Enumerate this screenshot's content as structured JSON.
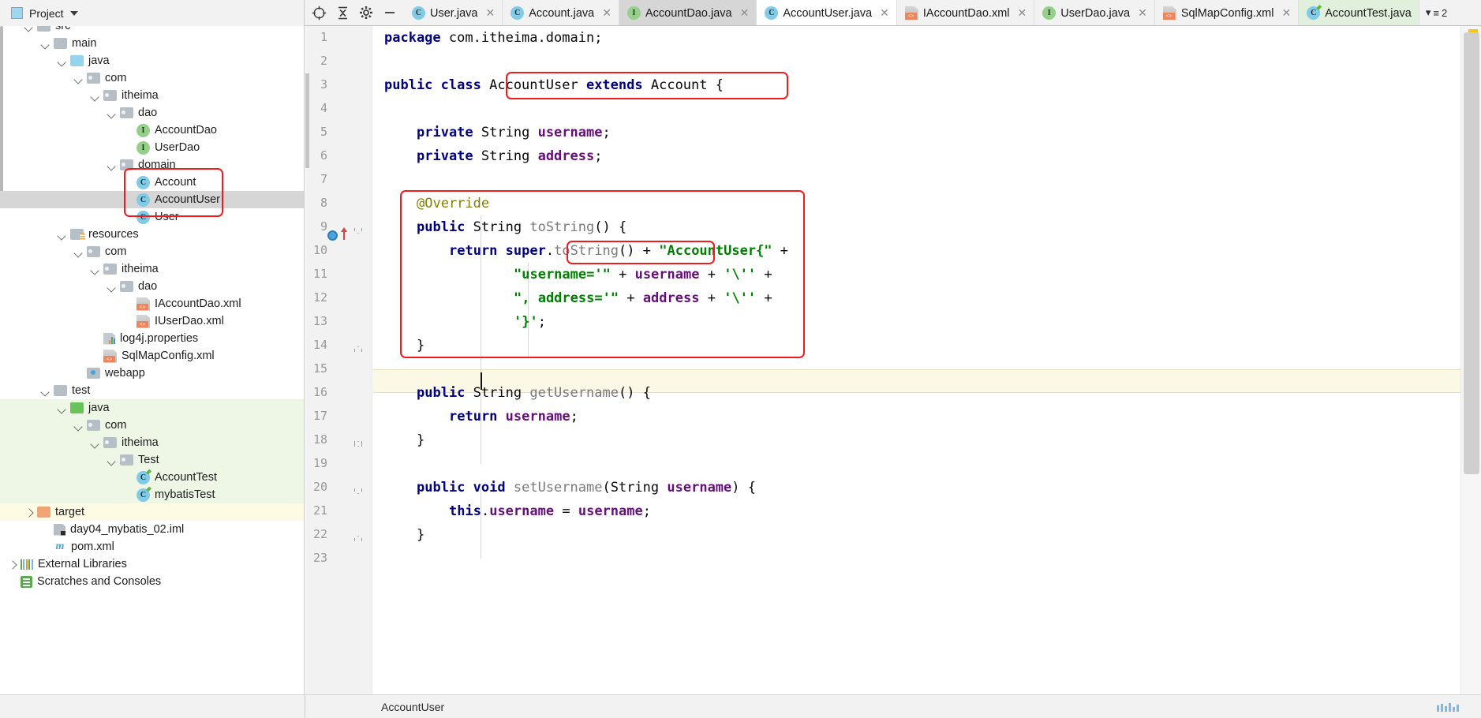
{
  "window": {
    "project_panel_title": "Project",
    "toolbar_icons": [
      "locate-icon",
      "collapse-all-icon",
      "settings-gear-icon",
      "hide-icon"
    ]
  },
  "tabs": {
    "items": [
      {
        "label": "User.java",
        "icon": "class-icon",
        "state": "inactive",
        "closable": true
      },
      {
        "label": "Account.java",
        "icon": "class-icon",
        "state": "inactive",
        "closable": true
      },
      {
        "label": "AccountDao.java",
        "icon": "interface-icon",
        "state": "hover",
        "closable": true
      },
      {
        "label": "AccountUser.java",
        "icon": "class-icon",
        "state": "active",
        "closable": true
      },
      {
        "label": "IAccountDao.xml",
        "icon": "xml-file-icon",
        "state": "inactive",
        "closable": true
      },
      {
        "label": "UserDao.java",
        "icon": "interface-icon",
        "state": "inactive",
        "closable": true
      },
      {
        "label": "SqlMapConfig.xml",
        "icon": "xml-file-icon",
        "state": "inactive",
        "closable": true
      },
      {
        "label": "AccountTest.java",
        "icon": "test-class-icon",
        "state": "runnable",
        "closable": false
      }
    ],
    "overflow_count": "2"
  },
  "tree": {
    "items": [
      {
        "label": "src",
        "indent": 1,
        "icon": "folder-grey",
        "arrow": "down",
        "bg": "none",
        "clipped": true
      },
      {
        "label": "main",
        "indent": 2,
        "icon": "folder-grey",
        "arrow": "down",
        "bg": "none"
      },
      {
        "label": "java",
        "indent": 3,
        "icon": "folder-blue",
        "arrow": "down",
        "bg": "none"
      },
      {
        "label": "com",
        "indent": 4,
        "icon": "package",
        "arrow": "down",
        "bg": "none"
      },
      {
        "label": "itheima",
        "indent": 5,
        "icon": "package",
        "arrow": "down",
        "bg": "none"
      },
      {
        "label": "dao",
        "indent": 6,
        "icon": "package",
        "arrow": "down",
        "bg": "none"
      },
      {
        "label": "AccountDao",
        "indent": 7,
        "icon": "interface-icon",
        "arrow": "none",
        "bg": "none"
      },
      {
        "label": "UserDao",
        "indent": 7,
        "icon": "interface-icon",
        "arrow": "none",
        "bg": "none"
      },
      {
        "label": "domain",
        "indent": 6,
        "icon": "package",
        "arrow": "down",
        "bg": "none"
      },
      {
        "label": "Account",
        "indent": 7,
        "icon": "class-icon",
        "arrow": "none",
        "bg": "none"
      },
      {
        "label": "AccountUser",
        "indent": 7,
        "icon": "class-icon",
        "arrow": "none",
        "bg": "selected"
      },
      {
        "label": "User",
        "indent": 7,
        "icon": "class-icon",
        "arrow": "none",
        "bg": "none"
      },
      {
        "label": "resources",
        "indent": 3,
        "icon": "folder-resources",
        "arrow": "down",
        "bg": "none"
      },
      {
        "label": "com",
        "indent": 4,
        "icon": "package",
        "arrow": "down",
        "bg": "none"
      },
      {
        "label": "itheima",
        "indent": 5,
        "icon": "package",
        "arrow": "down",
        "bg": "none"
      },
      {
        "label": "dao",
        "indent": 6,
        "icon": "package",
        "arrow": "down",
        "bg": "none"
      },
      {
        "label": "IAccountDao.xml",
        "indent": 7,
        "icon": "xml-file-icon",
        "arrow": "none",
        "bg": "none"
      },
      {
        "label": "IUserDao.xml",
        "indent": 7,
        "icon": "xml-file-icon",
        "arrow": "none",
        "bg": "none"
      },
      {
        "label": "log4j.properties",
        "indent": 5,
        "icon": "properties-file-icon",
        "arrow": "none",
        "bg": "none"
      },
      {
        "label": "SqlMapConfig.xml",
        "indent": 5,
        "icon": "xml-file-icon",
        "arrow": "none",
        "bg": "none"
      },
      {
        "label": "webapp",
        "indent": 4,
        "icon": "folder-web",
        "arrow": "none",
        "bg": "none"
      },
      {
        "label": "test",
        "indent": 2,
        "icon": "folder-grey",
        "arrow": "down",
        "bg": "none"
      },
      {
        "label": "java",
        "indent": 3,
        "icon": "folder-green",
        "arrow": "down",
        "bg": "green"
      },
      {
        "label": "com",
        "indent": 4,
        "icon": "package",
        "arrow": "down",
        "bg": "green"
      },
      {
        "label": "itheima",
        "indent": 5,
        "icon": "package",
        "arrow": "down",
        "bg": "green"
      },
      {
        "label": "Test",
        "indent": 6,
        "icon": "package",
        "arrow": "down",
        "bg": "green"
      },
      {
        "label": "AccountTest",
        "indent": 7,
        "icon": "test-class-icon",
        "arrow": "none",
        "bg": "green"
      },
      {
        "label": "mybatisTest",
        "indent": 7,
        "icon": "test-class-icon",
        "arrow": "none",
        "bg": "green"
      },
      {
        "label": "target",
        "indent": 1,
        "icon": "folder-orange",
        "arrow": "right",
        "bg": "yellow"
      },
      {
        "label": "day04_mybatis_02.iml",
        "indent": 2,
        "icon": "iml-file-icon",
        "arrow": "none",
        "bg": "none"
      },
      {
        "label": "pom.xml",
        "indent": 2,
        "icon": "maven-icon",
        "arrow": "none",
        "bg": "none"
      },
      {
        "label": "External Libraries",
        "indent": 0,
        "icon": "libraries-icon",
        "arrow": "right",
        "bg": "none"
      },
      {
        "label": "Scratches and Consoles",
        "indent": 0,
        "icon": "scratches-icon",
        "arrow": "none",
        "bg": "none"
      }
    ]
  },
  "editor": {
    "line_numbers": [
      "1",
      "2",
      "3",
      "4",
      "5",
      "6",
      "7",
      "8",
      "9",
      "10",
      "11",
      "12",
      "13",
      "14",
      "15",
      "16",
      "17",
      "18",
      "19",
      "20",
      "21",
      "22",
      "23"
    ],
    "lines": [
      {
        "n": 1,
        "text": "package com.itheima.domain;"
      },
      {
        "n": 2,
        "text": ""
      },
      {
        "n": 3,
        "text": "public class AccountUser extends Account {"
      },
      {
        "n": 4,
        "text": ""
      },
      {
        "n": 5,
        "text": "    private String username;"
      },
      {
        "n": 6,
        "text": "    private String address;"
      },
      {
        "n": 7,
        "text": ""
      },
      {
        "n": 8,
        "text": "    @Override"
      },
      {
        "n": 9,
        "text": "    public String toString() {"
      },
      {
        "n": 10,
        "text": "        return super.toString() + \"AccountUser{\" +"
      },
      {
        "n": 11,
        "text": "                \"username='\" + username + '\\'' +"
      },
      {
        "n": 12,
        "text": "                \", address='\" + address + '\\'' +"
      },
      {
        "n": 13,
        "text": "                '}';"
      },
      {
        "n": 14,
        "text": "    }"
      },
      {
        "n": 15,
        "text": ""
      },
      {
        "n": 16,
        "text": "    public String getUsername() {"
      },
      {
        "n": 17,
        "text": "        return username;"
      },
      {
        "n": 18,
        "text": "    }"
      },
      {
        "n": 19,
        "text": ""
      },
      {
        "n": 20,
        "text": "    public void setUsername(String username) {"
      },
      {
        "n": 21,
        "text": "        this.username = username;"
      },
      {
        "n": 22,
        "text": "    }"
      },
      {
        "n": 23,
        "text": ""
      }
    ],
    "caret_line": 15,
    "gutter_markers": {
      "override_line": 9,
      "override_icon": "overridden-method-icon"
    }
  },
  "annotations": {
    "color": "#f01b1b",
    "boxes": [
      {
        "name": "domain-classes-highlight",
        "target": "tree domain classes Account/AccountUser/User"
      },
      {
        "name": "class-declaration-highlight",
        "target": "class AccountUser extends Account"
      },
      {
        "name": "tostring-method-highlight",
        "target": "@Override toString() block"
      },
      {
        "name": "super-tostring-highlight",
        "target": "super.toString()"
      }
    ]
  },
  "status": {
    "breadcrumb": "AccountUser"
  }
}
